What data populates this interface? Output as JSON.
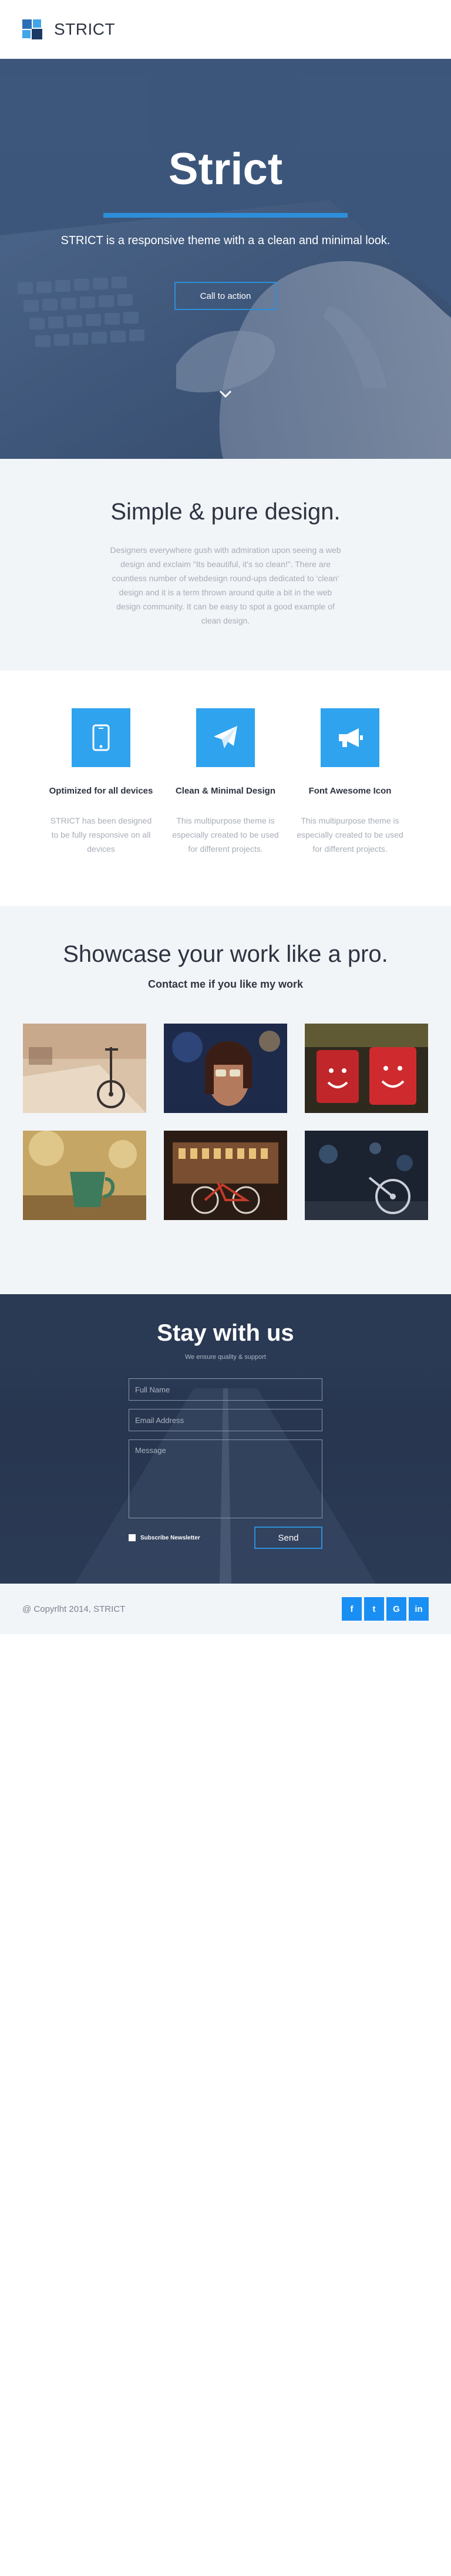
{
  "header": {
    "brand": "STRICT",
    "logo_icon": "strict-logo-icon"
  },
  "hero": {
    "title": "Strict",
    "subtitle": "STRICT is a responsive theme with a a clean and minimal look.",
    "cta_label": "Call to action",
    "scroll_icon": "chevron-down-icon",
    "accent": "#2d8fd9"
  },
  "design": {
    "title": "Simple & pure design.",
    "body": "Designers everywhere gush with admiration upon seeing a web design and exclaim \"Its beautiful, it's so clean!\". There are countless number of webdesign round-ups dedicated to 'clean' design and it is a term thrown around quite a bit in the web design community. It can be easy to spot a good example of clean design."
  },
  "features": [
    {
      "icon": "mobile-icon",
      "title": "Optimized for all devices",
      "body": "STRICT has been designed to be fully responsive on all devices"
    },
    {
      "icon": "paper-plane-icon",
      "title": "Clean & Minimal Design",
      "body": "This multipurpose theme is especially created to be used for different projects."
    },
    {
      "icon": "bullhorn-icon",
      "title": "Font Awesome Icon",
      "body": "This multipurpose theme is especially created to be used for different projects."
    }
  ],
  "showcase": {
    "title": "Showcase your work like a pro.",
    "subtitle": "Contact me if you like my work"
  },
  "contact": {
    "title": "Stay with us",
    "tagline": "We ensure quality & support",
    "name_placeholder": "Full Name",
    "email_placeholder": "Email Address",
    "message_placeholder": "Message",
    "subscribe_label": "Subscribe Newsletter",
    "send_label": "Send"
  },
  "footer": {
    "copyright": "@ Copyrlht 2014, STRICT",
    "social": [
      {
        "icon": "facebook-icon",
        "glyph": "f"
      },
      {
        "icon": "twitter-icon",
        "glyph": "t"
      },
      {
        "icon": "google-icon",
        "glyph": "G"
      },
      {
        "icon": "linkedin-icon",
        "glyph": "in"
      }
    ],
    "social_color": "#1a8ff3"
  }
}
